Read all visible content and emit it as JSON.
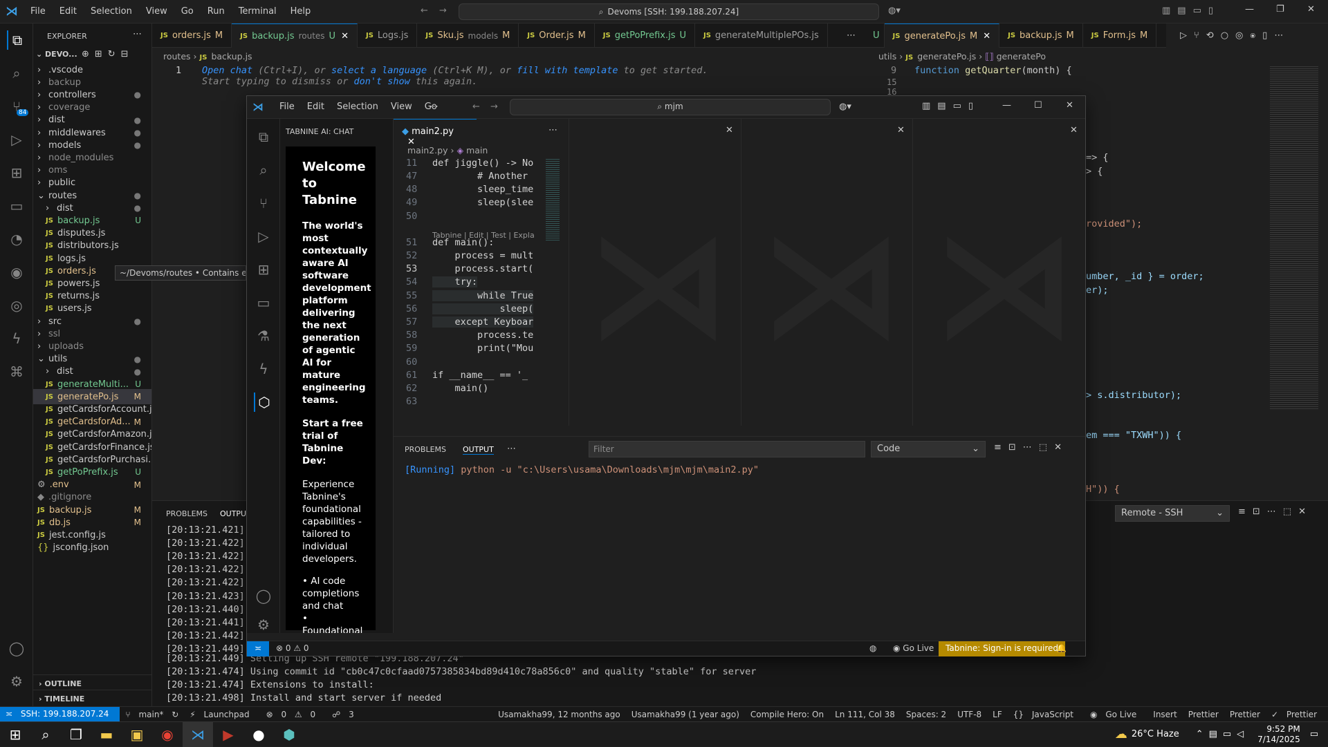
{
  "titlebar": {
    "menu": [
      "File",
      "Edit",
      "Selection",
      "View",
      "Go",
      "Run",
      "Terminal",
      "Help"
    ],
    "search": "Devoms [SSH: 199.188.207.24]"
  },
  "explorer": {
    "header": "EXPLORER",
    "root": "DEVO...",
    "tooltip": "~/Devoms/routes • Contains empl",
    "items": [
      {
        "label": ".vscode",
        "kind": "folder",
        "depth": 0,
        "badge": ""
      },
      {
        "label": "backup",
        "kind": "folder",
        "depth": 0,
        "badge": ""
      },
      {
        "label": "controllers",
        "kind": "folder",
        "depth": 0,
        "badge": "●"
      },
      {
        "label": "coverage",
        "kind": "folder",
        "depth": 0,
        "badge": ""
      },
      {
        "label": "dist",
        "kind": "folder",
        "depth": 0,
        "badge": "●"
      },
      {
        "label": "middlewares",
        "kind": "folder",
        "depth": 0,
        "badge": "●"
      },
      {
        "label": "models",
        "kind": "folder",
        "depth": 0,
        "badge": "●"
      },
      {
        "label": "node_modules",
        "kind": "folder",
        "depth": 0,
        "badge": ""
      },
      {
        "label": "oms",
        "kind": "folder",
        "depth": 0,
        "badge": ""
      },
      {
        "label": "public",
        "kind": "folder",
        "depth": 0,
        "badge": ""
      },
      {
        "label": "routes",
        "kind": "folder-open",
        "depth": 0,
        "badge": "●"
      },
      {
        "label": "dist",
        "kind": "folder",
        "depth": 1,
        "badge": "●"
      },
      {
        "label": "backup.js",
        "kind": "js",
        "depth": 1,
        "badge": "U"
      },
      {
        "label": "disputes.js",
        "kind": "js",
        "depth": 1,
        "badge": ""
      },
      {
        "label": "distributors.js",
        "kind": "js",
        "depth": 1,
        "badge": ""
      },
      {
        "label": "logs.js",
        "kind": "js",
        "depth": 1,
        "badge": ""
      },
      {
        "label": "orders.js",
        "kind": "js",
        "depth": 1,
        "badge": "M"
      },
      {
        "label": "powers.js",
        "kind": "js",
        "depth": 1,
        "badge": ""
      },
      {
        "label": "returns.js",
        "kind": "js",
        "depth": 1,
        "badge": ""
      },
      {
        "label": "users.js",
        "kind": "js",
        "depth": 1,
        "badge": ""
      },
      {
        "label": "src",
        "kind": "folder",
        "depth": 0,
        "badge": "●"
      },
      {
        "label": "ssl",
        "kind": "folder",
        "depth": 0,
        "badge": ""
      },
      {
        "label": "uploads",
        "kind": "folder",
        "depth": 0,
        "badge": ""
      },
      {
        "label": "utils",
        "kind": "folder-open",
        "depth": 0,
        "badge": "●"
      },
      {
        "label": "dist",
        "kind": "folder",
        "depth": 1,
        "badge": "●"
      },
      {
        "label": "generateMulti...",
        "kind": "js",
        "depth": 1,
        "badge": "U"
      },
      {
        "label": "generatePo.js",
        "kind": "js",
        "depth": 1,
        "badge": "M"
      },
      {
        "label": "getCardsforAccount.js",
        "kind": "js",
        "depth": 1,
        "badge": ""
      },
      {
        "label": "getCardsforAd...",
        "kind": "js",
        "depth": 1,
        "badge": "M"
      },
      {
        "label": "getCardsforAmazon.js",
        "kind": "js",
        "depth": 1,
        "badge": ""
      },
      {
        "label": "getCardsforFinance.js",
        "kind": "js",
        "depth": 1,
        "badge": ""
      },
      {
        "label": "getCardsforPurchasi...",
        "kind": "js",
        "depth": 1,
        "badge": ""
      },
      {
        "label": "getPoPrefix.js",
        "kind": "js",
        "depth": 1,
        "badge": "U"
      },
      {
        "label": ".env",
        "kind": "gear",
        "depth": 0,
        "badge": "M"
      },
      {
        "label": ".gitignore",
        "kind": "file",
        "depth": 0,
        "badge": ""
      },
      {
        "label": "backup.js",
        "kind": "js",
        "depth": 0,
        "badge": "M"
      },
      {
        "label": "db.js",
        "kind": "js",
        "depth": 0,
        "badge": "M"
      },
      {
        "label": "jest.config.js",
        "kind": "js",
        "depth": 0,
        "badge": ""
      },
      {
        "label": "jsconfig.json",
        "kind": "json",
        "depth": 0,
        "badge": ""
      }
    ],
    "outline": "OUTLINE",
    "timeline": "TIMELINE"
  },
  "tabs_left": [
    {
      "label": "orders.js",
      "extra": "",
      "badge": "M",
      "active": false
    },
    {
      "label": "backup.js",
      "extra": "routes",
      "badge": "U",
      "active": true
    },
    {
      "label": "Logs.js",
      "extra": "",
      "badge": "",
      "active": false
    },
    {
      "label": "Sku.js",
      "extra": "models",
      "badge": "M",
      "active": false
    },
    {
      "label": "Order.js",
      "extra": "",
      "badge": "M",
      "active": false
    },
    {
      "label": "getPoPrefix.js",
      "extra": "",
      "badge": "U",
      "active": false
    },
    {
      "label": "generateMultiplePOs.js",
      "extra": "",
      "badge": "",
      "active": false
    }
  ],
  "tabs_right": [
    {
      "label": "generatePo.js",
      "badge": "M",
      "active": true
    },
    {
      "label": "backup.js",
      "badge": "M",
      "active": false
    },
    {
      "label": "Form.js",
      "badge": "M",
      "active": false
    }
  ],
  "editor_left": {
    "breadcrumb": [
      "routes",
      "backup.js"
    ],
    "line_no": "1",
    "hint1": {
      "a": "Open chat",
      "b": " (Ctrl+I), or ",
      "c": "select a language",
      "d": " (Ctrl+K M), or ",
      "e": "fill with template",
      "f": " to get started."
    },
    "hint2": {
      "a": "Start typing to dismiss or ",
      "b": "don't show",
      "c": " this again."
    }
  },
  "editor_right": {
    "breadcrumb": [
      "utils",
      "generatePo.js",
      "generatePo"
    ],
    "l9": "9",
    "code9_kw": "function",
    "code9_fn": "getQuarter",
    "code9_rest": "(month) {",
    "l15": "15",
    "l16": "16",
    "frag_a": "=> {",
    "frag_b": "> {",
    "frag_c": "rovided\");",
    "frag_d": "umber, _id } = order;",
    "frag_e": "er);",
    "frag_f": "> s.distributor);",
    "frag_g": "em === \"TXWH\")) {",
    "frag_h": "H\")) {"
  },
  "bottom_left": {
    "tabs": [
      "PROBLEMS",
      "OUTPU"
    ],
    "times": [
      "[20:13:21.421]",
      "[20:13:21.422]",
      "[20:13:21.422]",
      "[20:13:21.422]",
      "[20:13:21.422]",
      "[20:13:21.423]",
      "[20:13:21.440]",
      "[20:13:21.441]",
      "[20:13:21.442]",
      "[20:13:21.449]"
    ],
    "lines": [
      "[20:13:21.449] Setting up SSH remote \"199.188.207.24\"",
      "[20:13:21.474] Using commit id \"cb0c47c0cfaad0757385834bd89d410c78a856c0\" and quality \"stable\" for server",
      "[20:13:21.474] Extensions to install:",
      "[20:13:21.498] Install and start server if needed"
    ],
    "remote_select": "Remote - SSH"
  },
  "status": {
    "ssh": "SSH: 199.188.207.24",
    "branch": "main*",
    "launchpad": "Launchpad",
    "errors": "0",
    "warnings": "0",
    "ports": "3",
    "blame1": "Usamakha99, 12 months ago",
    "blame2": "Usamakha99 (1 year ago)",
    "compile": "Compile Hero: On",
    "pos": "Ln 111, Col 38",
    "spaces": "Spaces: 2",
    "enc": "UTF-8",
    "eol": "LF",
    "lang": "JavaScript",
    "golive": "Go Live",
    "insert": "Insert",
    "prettier1": "Prettier",
    "prettier2": "Prettier",
    "prettier3": "Prettier"
  },
  "taskbar": {
    "weather": "26°C Haze",
    "time": "9:52 PM",
    "date": "7/14/2025"
  },
  "win2": {
    "menu": [
      "File",
      "Edit",
      "Selection",
      "View",
      "Go"
    ],
    "search": "mjm",
    "tabnine": {
      "header": "TABNINE AI: CHAT",
      "title": "Welcome to Tabnine",
      "p1": "The world's most contextually aware AI software development platform delivering the next generation of agentic AI for mature engineering teams.",
      "p2": "Start a free trial of Tabnine Dev:",
      "p3": "Experience Tabnine's foundational capabilities - tailored to individual developers.",
      "b1": "AI code completions and chat",
      "b2": "Foundational"
    },
    "tab": "main2.py",
    "breadcrumb": [
      "main2.py",
      "main"
    ],
    "codelens": "Tabnine | Edit | Test | Expla",
    "lines": [
      {
        "n": "11",
        "t": "def jiggle() -> No"
      },
      {
        "n": "47",
        "t": "        # Another"
      },
      {
        "n": "48",
        "t": "        sleep_time"
      },
      {
        "n": "49",
        "t": "        sleep(slee"
      },
      {
        "n": "50",
        "t": ""
      },
      {
        "n": "51",
        "t": "def main():"
      },
      {
        "n": "52",
        "t": "    process = mult"
      },
      {
        "n": "53",
        "t": "    process.start("
      },
      {
        "n": "54",
        "t": "    try:"
      },
      {
        "n": "55",
        "t": "        while True"
      },
      {
        "n": "56",
        "t": "            sleep("
      },
      {
        "n": "57",
        "t": "    except Keyboar"
      },
      {
        "n": "58",
        "t": "        process.te"
      },
      {
        "n": "59",
        "t": "        print(\"Mou"
      },
      {
        "n": "60",
        "t": ""
      },
      {
        "n": "61",
        "t": "if __name__ == '_"
      },
      {
        "n": "62",
        "t": "    main()"
      },
      {
        "n": "63",
        "t": ""
      }
    ],
    "panel_tabs": [
      "PROBLEMS",
      "OUTPUT"
    ],
    "filter_placeholder": "Filter",
    "channel": "Code",
    "run_tag": "[Running]",
    "run_cmd": " python -u \"c:\\Users\\usama\\Downloads\\mjm\\mjm\\main2.py\"",
    "status": {
      "errors": "0",
      "warnings": "0",
      "golive": "Go Live",
      "tabnine": "Tabnine: Sign-in is required"
    }
  },
  "colors": {
    "accent": "#0078d4",
    "modified": "#e2c08d",
    "untracked": "#73c991"
  }
}
